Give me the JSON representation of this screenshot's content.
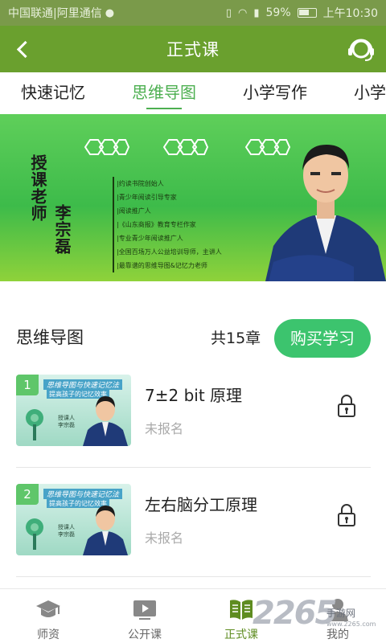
{
  "status_bar": {
    "carrier": "中国联通|阿里通信",
    "battery": "59%",
    "time": "上午10:30"
  },
  "nav": {
    "title": "正式课"
  },
  "tabs": [
    "快速记忆",
    "思维导图",
    "小学写作",
    "小学"
  ],
  "banner": {
    "teacher_label": "授课老师",
    "teacher_name": "李宗磊",
    "credentials": [
      "|约读书院创始人",
      "|青少年阅读引导专家",
      "|阅读推广人",
      "|《山东商报》教育专栏作家",
      "|专业青少年阅读推广人",
      "|全国百场万人公益培训导师，主讲人",
      "|最靠谱的思维导图&记忆力老师"
    ]
  },
  "section": {
    "title": "思维导图",
    "count": "共15章",
    "buy_label": "购买学习"
  },
  "lessons": [
    {
      "num": "1",
      "title": "7±2 bit 原理",
      "status": "未报名",
      "thumb_title": "思维导图与快速记忆法",
      "thumb_sub": "提高孩子的记忆效率",
      "thumb_teacher": "授课人 李宗磊"
    },
    {
      "num": "2",
      "title": "左右脑分工原理",
      "status": "未报名",
      "thumb_title": "思维导图与快速记忆法",
      "thumb_sub": "提高孩子的记忆效率",
      "thumb_teacher": "授课人 李宗磊"
    }
  ],
  "bottom_nav": [
    {
      "label": "师资",
      "icon": "graduation-cap-icon"
    },
    {
      "label": "公开课",
      "icon": "video-play-icon"
    },
    {
      "label": "正式课",
      "icon": "open-book-icon"
    },
    {
      "label": "我的",
      "icon": "person-icon"
    }
  ],
  "watermark": {
    "big": "2265",
    "small": "手游网",
    "url": "www.2265.com"
  },
  "colors": {
    "nav": "#6aa02e",
    "accent_green": "#4caf50",
    "buy_button": "#3cc46e",
    "banner": "#3dbb4a"
  }
}
